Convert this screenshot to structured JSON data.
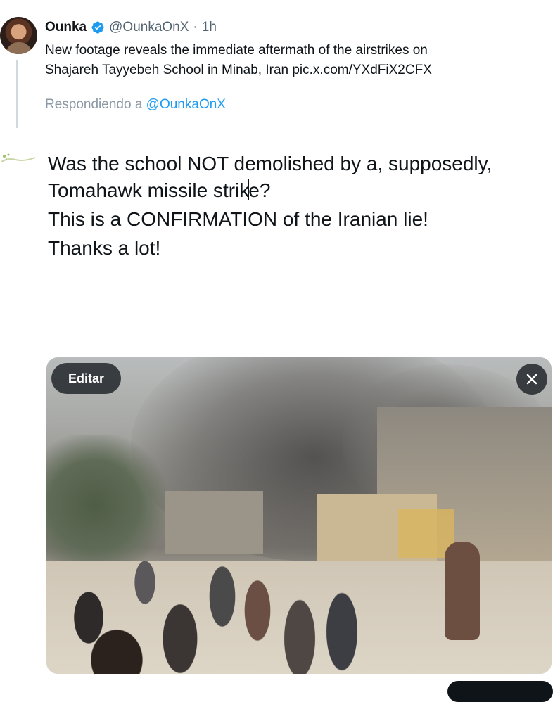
{
  "quoted_tweet": {
    "author_name": "Ounka",
    "author_handle": "@OunkaOnX",
    "separator": "·",
    "time": "1h",
    "text_lines": [
      "New footage reveals the immediate aftermath of the airstrikes on",
      "Shajareh Tayyebeh School in Minab, Iran pic.x.com/YXdFiX2CFX"
    ],
    "verified_color": "#1d9bf0"
  },
  "reply_context": {
    "prefix": "Respondiendo a",
    "mention": "@OunkaOnX"
  },
  "compose": {
    "line1": "Was the school NOT demolished by a, supposedly,",
    "line2_before_caret": "Tomahawk missile strik",
    "line2_after_caret": "e?",
    "line3": "This is a CONFIRMATION of the Iranian lie!",
    "line4": "Thanks a lot!"
  },
  "media": {
    "edit_label": "Editar",
    "close_icon": "close-icon"
  },
  "colors": {
    "text": "#0f1419",
    "secondary": "#536471",
    "link": "#1d9bf0",
    "overlay_button": "#0f1419"
  }
}
